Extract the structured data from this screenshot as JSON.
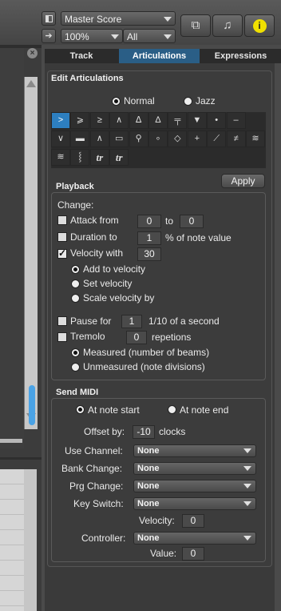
{
  "toolbar": {
    "score_select": "Master Score",
    "zoom_select": "100%",
    "filter_select": "All",
    "panel_icon": "panel-icon",
    "go_icon": "arrow-right-icon"
  },
  "tabs": [
    {
      "label": "Track",
      "active": false
    },
    {
      "label": "Articulations",
      "active": true
    },
    {
      "label": "Expressions",
      "active": false
    }
  ],
  "edit_section": {
    "title": "Edit Articulations",
    "mode_normal": "Normal",
    "mode_jazz": "Jazz",
    "selected_mode": "Normal"
  },
  "articulations": {
    "row1": [
      ">",
      "⩾",
      "≥",
      "∧",
      "ᐃ",
      "∆",
      "╤",
      "▼",
      "•",
      "–"
    ],
    "row2": [
      "∨",
      "▬",
      "∧",
      "▭",
      "⚲",
      "∘",
      "◇",
      "+",
      "⟋",
      "≠",
      "≋"
    ],
    "row3": [
      "≋",
      "⸾",
      "tr",
      "tr"
    ],
    "selected_index": 0
  },
  "playback": {
    "apply_label": "Apply",
    "title": "Playback",
    "change_label": "Change:",
    "attack_label": "Attack from",
    "attack_from": "0",
    "to_label": "to",
    "attack_to": "0",
    "duration_label": "Duration to",
    "duration_value": "1",
    "duration_unit": "% of note value",
    "velocity_label": "Velocity with",
    "velocity_value": "30",
    "add_velocity": "Add to velocity",
    "set_velocity": "Set velocity",
    "scale_velocity": "Scale velocity by",
    "pause_label": "Pause for",
    "pause_value": "1",
    "pause_unit": "1/10 of a second",
    "tremolo_label": "Tremolo",
    "tremolo_value": "0",
    "tremolo_unit": "repetions",
    "measured": "Measured (number of beams)",
    "unmeasured": "Unmeasured (note divisions)"
  },
  "midi": {
    "title": "Send MIDI",
    "at_start": "At note start",
    "at_end": "At note end",
    "offset_label": "Offset by:",
    "offset_value": "-10",
    "offset_unit": "clocks",
    "use_channel_label": "Use Channel:",
    "use_channel": "None",
    "bank_change_label": "Bank Change:",
    "bank_change": "None",
    "prg_change_label": "Prg Change:",
    "prg_change": "None",
    "key_switch_label": "Key Switch:",
    "key_switch": "None",
    "velocity_label": "Velocity:",
    "velocity_value": "0",
    "controller_label": "Controller:",
    "controller": "None",
    "value_label": "Value:",
    "value_value": "0"
  },
  "colors": {
    "accent": "#2d7fc0",
    "tab_active": "#2a5e86",
    "info_button": "#f0e000"
  }
}
